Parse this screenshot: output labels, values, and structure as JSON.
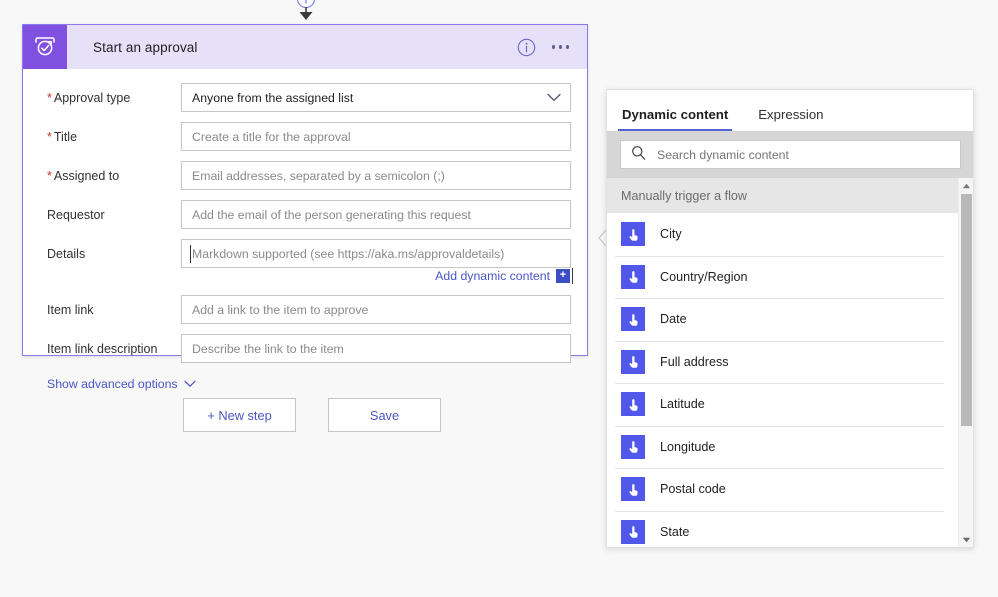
{
  "connector": {
    "add_icon": "plus-circle-icon"
  },
  "card": {
    "icon_name": "approval-icon",
    "title": "Start an approval",
    "info_icon": "info-icon",
    "more_icon": "ellipsis-icon",
    "accent_color": "#8050e0",
    "header_bg": "#e6e0f9",
    "border_color": "#8a7af0",
    "fields": [
      {
        "label": "Approval type",
        "required": true,
        "type": "select",
        "value": "Anyone from the assigned list",
        "placeholder": ""
      },
      {
        "label": "Title",
        "required": true,
        "type": "text",
        "value": "",
        "placeholder": "Create a title for the approval"
      },
      {
        "label": "Assigned to",
        "required": true,
        "type": "text",
        "value": "",
        "placeholder": "Email addresses, separated by a semicolon (;)"
      },
      {
        "label": "Requestor",
        "required": false,
        "type": "text",
        "value": "",
        "placeholder": "Add the email of the person generating this request"
      },
      {
        "label": "Details",
        "required": false,
        "type": "text",
        "value": "",
        "placeholder": "Markdown supported (see https://aka.ms/approvaldetails)",
        "focused": true
      },
      {
        "label": "Item link",
        "required": false,
        "type": "text",
        "value": "",
        "placeholder": "Add a link to the item to approve"
      },
      {
        "label": "Item link description",
        "required": false,
        "type": "text",
        "value": "",
        "placeholder": "Describe the link to the item"
      }
    ],
    "add_dynamic_content_label": "Add dynamic content",
    "add_dynamic_content_plus": "+",
    "show_advanced_label": "Show advanced options"
  },
  "buttons": {
    "new_step": "+ New step",
    "save": "Save"
  },
  "panel": {
    "tabs": [
      {
        "label": "Dynamic content",
        "active": true
      },
      {
        "label": "Expression",
        "active": false
      }
    ],
    "search": {
      "placeholder": "Search dynamic content",
      "value": "",
      "icon": "search-icon"
    },
    "group_title": "Manually trigger a flow",
    "item_icon": "touch-tap-icon",
    "item_icon_color": "#5157e8",
    "items": [
      {
        "label": "City"
      },
      {
        "label": "Country/Region"
      },
      {
        "label": "Date"
      },
      {
        "label": "Full address"
      },
      {
        "label": "Latitude"
      },
      {
        "label": "Longitude"
      },
      {
        "label": "Postal code"
      },
      {
        "label": "State"
      }
    ],
    "scrollbar": {
      "up_icon": "scroll-up-icon",
      "down_icon": "scroll-down-icon"
    }
  }
}
